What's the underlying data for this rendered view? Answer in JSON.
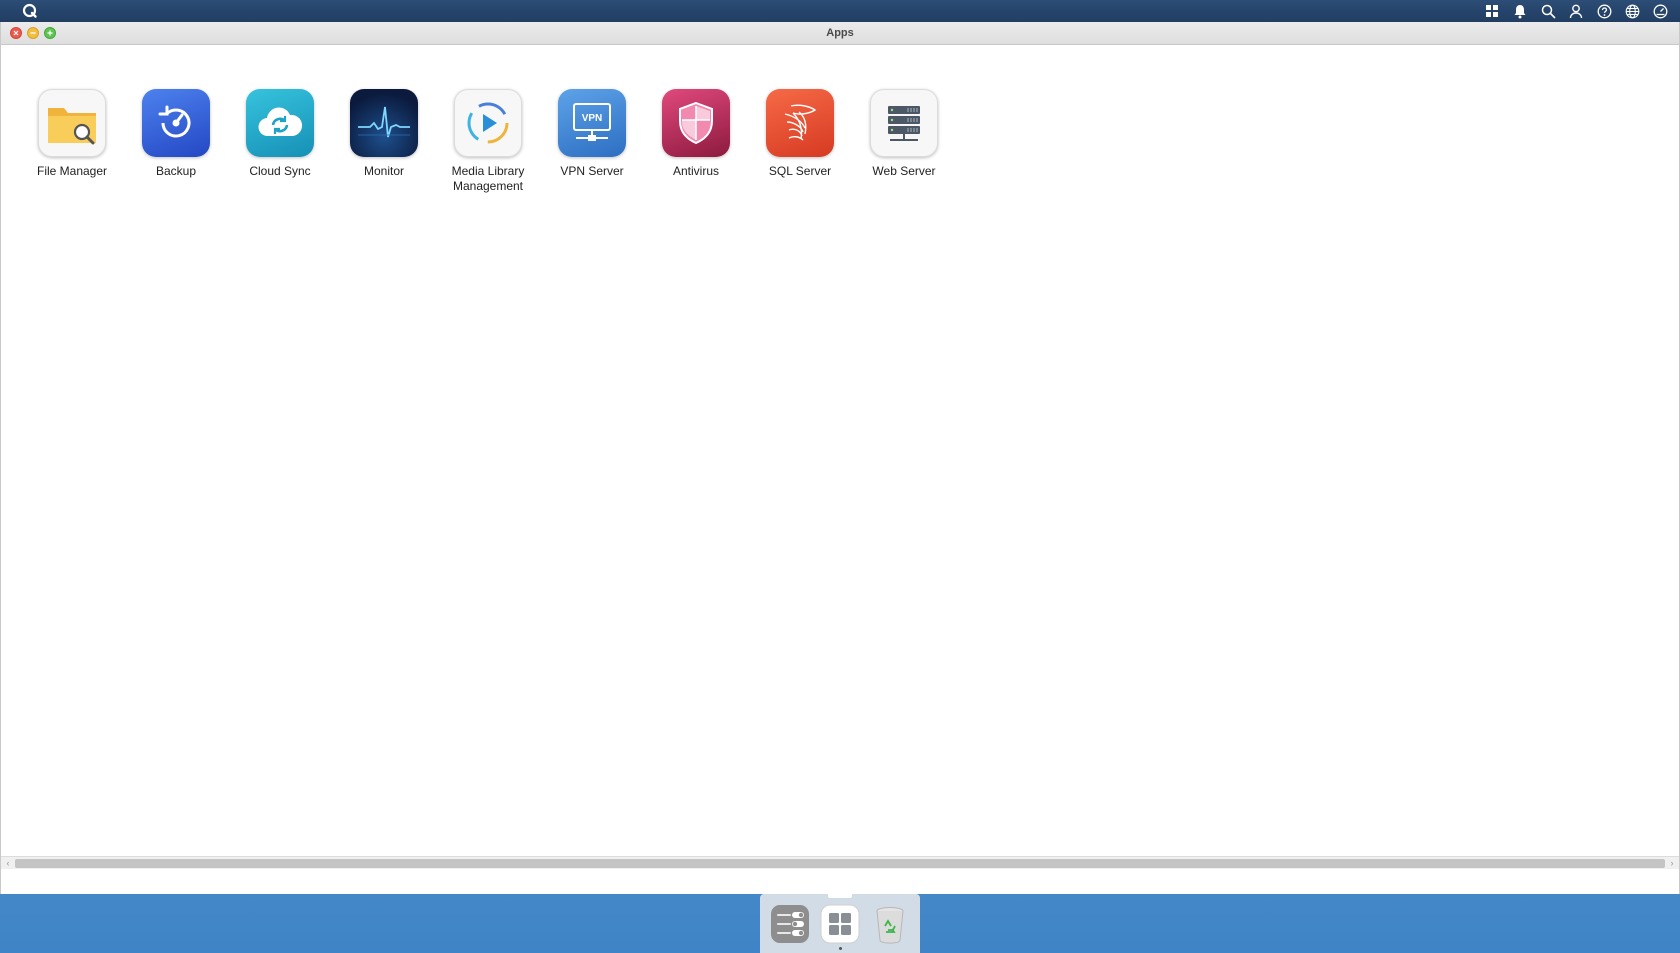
{
  "window": {
    "title": "Apps"
  },
  "topbar": {
    "icons": [
      "apps-grid-icon",
      "notifications-bell-icon",
      "search-icon",
      "user-icon",
      "help-icon",
      "language-globe-icon",
      "dashboard-gauge-icon"
    ]
  },
  "apps": [
    {
      "label": "File Manager",
      "icon": "file-manager-icon"
    },
    {
      "label": "Backup",
      "icon": "backup-icon"
    },
    {
      "label": "Cloud Sync",
      "icon": "cloud-sync-icon"
    },
    {
      "label": "Monitor",
      "icon": "monitor-icon"
    },
    {
      "label": "Media Library Management",
      "icon": "media-library-icon"
    },
    {
      "label": "VPN Server",
      "icon": "vpn-server-icon",
      "badge": "VPN"
    },
    {
      "label": "Antivirus",
      "icon": "antivirus-icon"
    },
    {
      "label": "SQL Server",
      "icon": "sql-server-icon"
    },
    {
      "label": "Web Server",
      "icon": "web-server-icon"
    }
  ],
  "dock": {
    "items": [
      "control-panel-icon",
      "apps-launcher-icon",
      "recycle-bin-icon"
    ]
  },
  "colors": {
    "topbar": "#213d62",
    "backup": "#2f5fd6",
    "cloud_sync": "#1fa3c4",
    "monitor": "#0f1f45",
    "vpn": "#3b86d4",
    "antivirus": "#c8285f",
    "sql": "#e64a2e"
  }
}
